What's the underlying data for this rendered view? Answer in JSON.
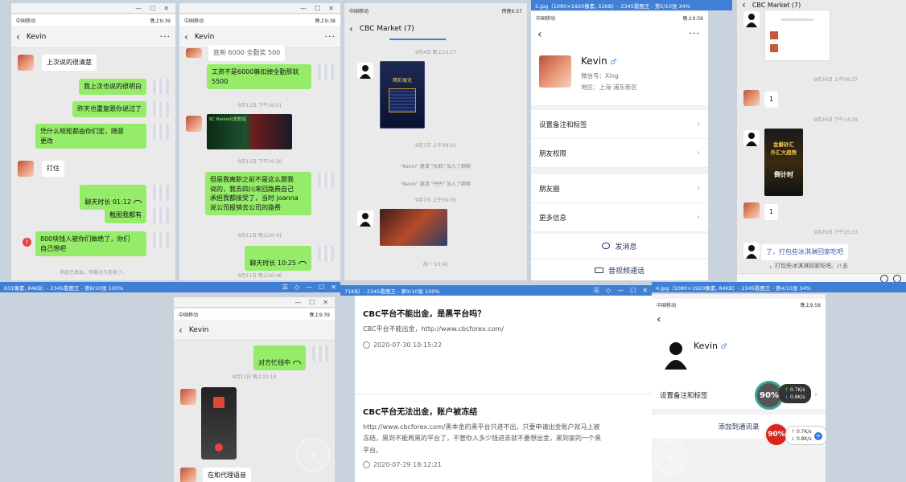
{
  "status_bar": {
    "carrier": "中国移动",
    "time_a": "晚上9:39",
    "time_b": "晚上9:38",
    "time_c": "傍晚6:57",
    "time_d": "晚上9:58",
    "time_e": "晚上9:39",
    "time_f": "晚上9:58"
  },
  "p1": {
    "contact": "Kevin",
    "messages": [
      {
        "side": "them",
        "text": "上次说的很清楚"
      },
      {
        "side": "me",
        "text": "我上次也说的很明白"
      },
      {
        "side": "me",
        "text": "昨天也重复跟你说过了"
      },
      {
        "side": "me",
        "text": "凭什么规矩都由你们定，随意\n更改"
      },
      {
        "side": "them",
        "text": "打住"
      },
      {
        "side": "me",
        "text": "聊天时长 01:12"
      },
      {
        "side": "me",
        "text": "截图我都有"
      },
      {
        "side": "me",
        "text": "800块钱人被你们做绝了，你们\n自己想吧"
      }
    ],
    "footer": "消息已发出，但被对方拒收了。"
  },
  "p2": {
    "contact": "Kevin",
    "top_cut": "底新 6000 全勤奖 500",
    "msg1": "工资不是6000嘛扣掉全勤那就\n5500",
    "time1": "9月11日 下午16:01",
    "time2": "9月11日 下午16:20",
    "msg2": "但是我离职之前不是这么跟我\n说的，我去四川来回路费自己\n承担我都接受了，当时 joanna\n说公司报销去公司的路费",
    "time3": "9月11日 晚上20:41",
    "msg3": "聊天时长 10:25",
    "time4": "9月11日 晚上20:46",
    "image_caption": "BC Market社群群福"
  },
  "p3": {
    "title": "CBC Market (7)",
    "time1": "9月4日 晚上10:17",
    "time2": "9月7日 上午09:01",
    "sys1": "\"Kevin\" 邀请 \"丸取\" 加入了群聊",
    "sys2": "\"Kevin\" 邀请 \"丹丹\" 加入了群聊",
    "time3": "9月7日 上午09:05",
    "time4": "周一 10:41",
    "card_title": "精彩展览"
  },
  "p4": {
    "name": "Kevin",
    "wechat_id": "微信号：Xing",
    "region": "地区：上海  浦东新区",
    "rows": [
      "设置备注和标签",
      "朋友权限",
      "朋友圈",
      "更多信息"
    ],
    "send_message": "发消息",
    "video_call": "音视频通话",
    "window_title": "5.jpg（1080×1920像素, 52KB）- 2345看图王 - 第5/10张 34%"
  },
  "p5": {
    "title": "CBC Market (7)",
    "time1": "9月26日 上午09:37",
    "msg1": "1",
    "time2": "9月26日 下午14:39",
    "time3": "9月26日 下午15:33",
    "msg2": "1",
    "poster_line1": "金爵砂汇",
    "poster_line2": "外汇大趋势",
    "poster_line3": "倒计时",
    "msg3": "了，打包些冰淇淋回家吃吧",
    "msg4": "，打包些冰淇淋回家吃吧。八五"
  },
  "p6": {
    "window_title": "631像素, 84KB）- 2345看图王 - 第8/10张 100%",
    "contact": "Kevin",
    "msg1": "对方忙线中",
    "time1": "9月11日 晚上22:14",
    "msg2": "在和代理语音"
  },
  "p7": {
    "window_title": "71KB）- 2345看图王 - 第9/10张 100%",
    "a1_title": "CBC平台不能出金，是黑平台吗？",
    "a1_body": "CBC平台不能出金，http://www.cbcforex.com/",
    "a1_date": "2020-07-30 10:15:22",
    "a2_title": "CBC平台无法出金，账户被冻结",
    "a2_body": "http://www.cbcforex.com/黑本金的黑平台只进不出，只要申请出金账户就马上被\n冻结，黑到不能再黑的平台了，不管你入多少钱进去就不要想出金，黑到家的一个黑\n平台。",
    "a2_date": "2020-07-29 18:12:21"
  },
  "p8": {
    "window_title": "4.jpg（1080×1920像素, 84KB）- 2345看图王 - 第4/10张 34%",
    "name": "Kevin",
    "row1": "设置备注和标签",
    "add_contact": "添加到通讯录",
    "gauge1": "90%",
    "gauge2": "90%",
    "speed_up": "0.7K/s",
    "speed_down": "0.8K/s",
    "speed_up2": "0.7K/s",
    "speed_down2": "0.8K/s"
  }
}
